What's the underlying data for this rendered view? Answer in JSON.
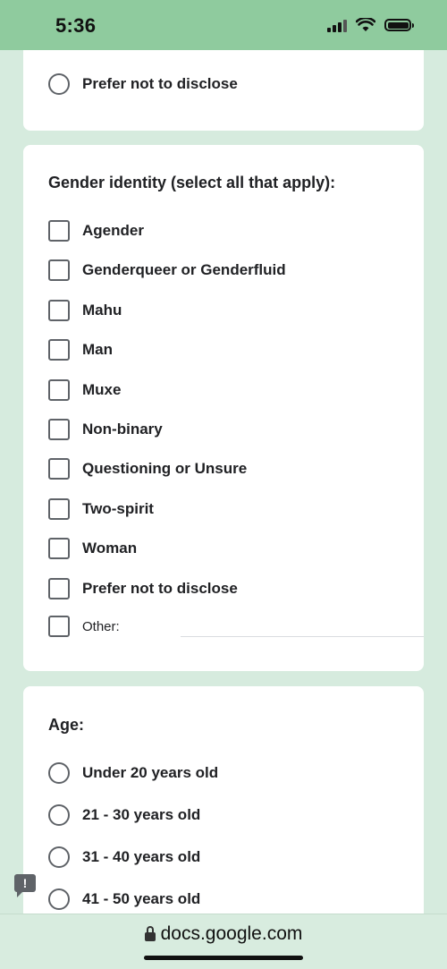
{
  "status_bar": {
    "time": "5:36"
  },
  "card1": {
    "options": [
      {
        "label": "Prefer not to disclose"
      }
    ]
  },
  "gender": {
    "title": "Gender identity (select all that apply):",
    "options": [
      {
        "label": "Agender"
      },
      {
        "label": "Genderqueer or Genderfluid"
      },
      {
        "label": "Mahu"
      },
      {
        "label": "Man"
      },
      {
        "label": "Muxe"
      },
      {
        "label": "Non-binary"
      },
      {
        "label": "Questioning or Unsure"
      },
      {
        "label": "Two-spirit"
      },
      {
        "label": "Woman"
      },
      {
        "label": "Prefer not to disclose"
      }
    ],
    "other_label": "Other:",
    "other_value": ""
  },
  "age": {
    "title": "Age:",
    "options": [
      {
        "label": "Under 20 years old"
      },
      {
        "label": "21 - 30 years old"
      },
      {
        "label": "31 - 40 years old"
      },
      {
        "label": "41 - 50 years old"
      }
    ]
  },
  "feedback": {
    "glyph": "!"
  },
  "browser": {
    "url": "docs.google.com"
  },
  "colors": {
    "background": "#d6ebde",
    "status_bar": "#8fcb9e",
    "card": "#ffffff"
  }
}
